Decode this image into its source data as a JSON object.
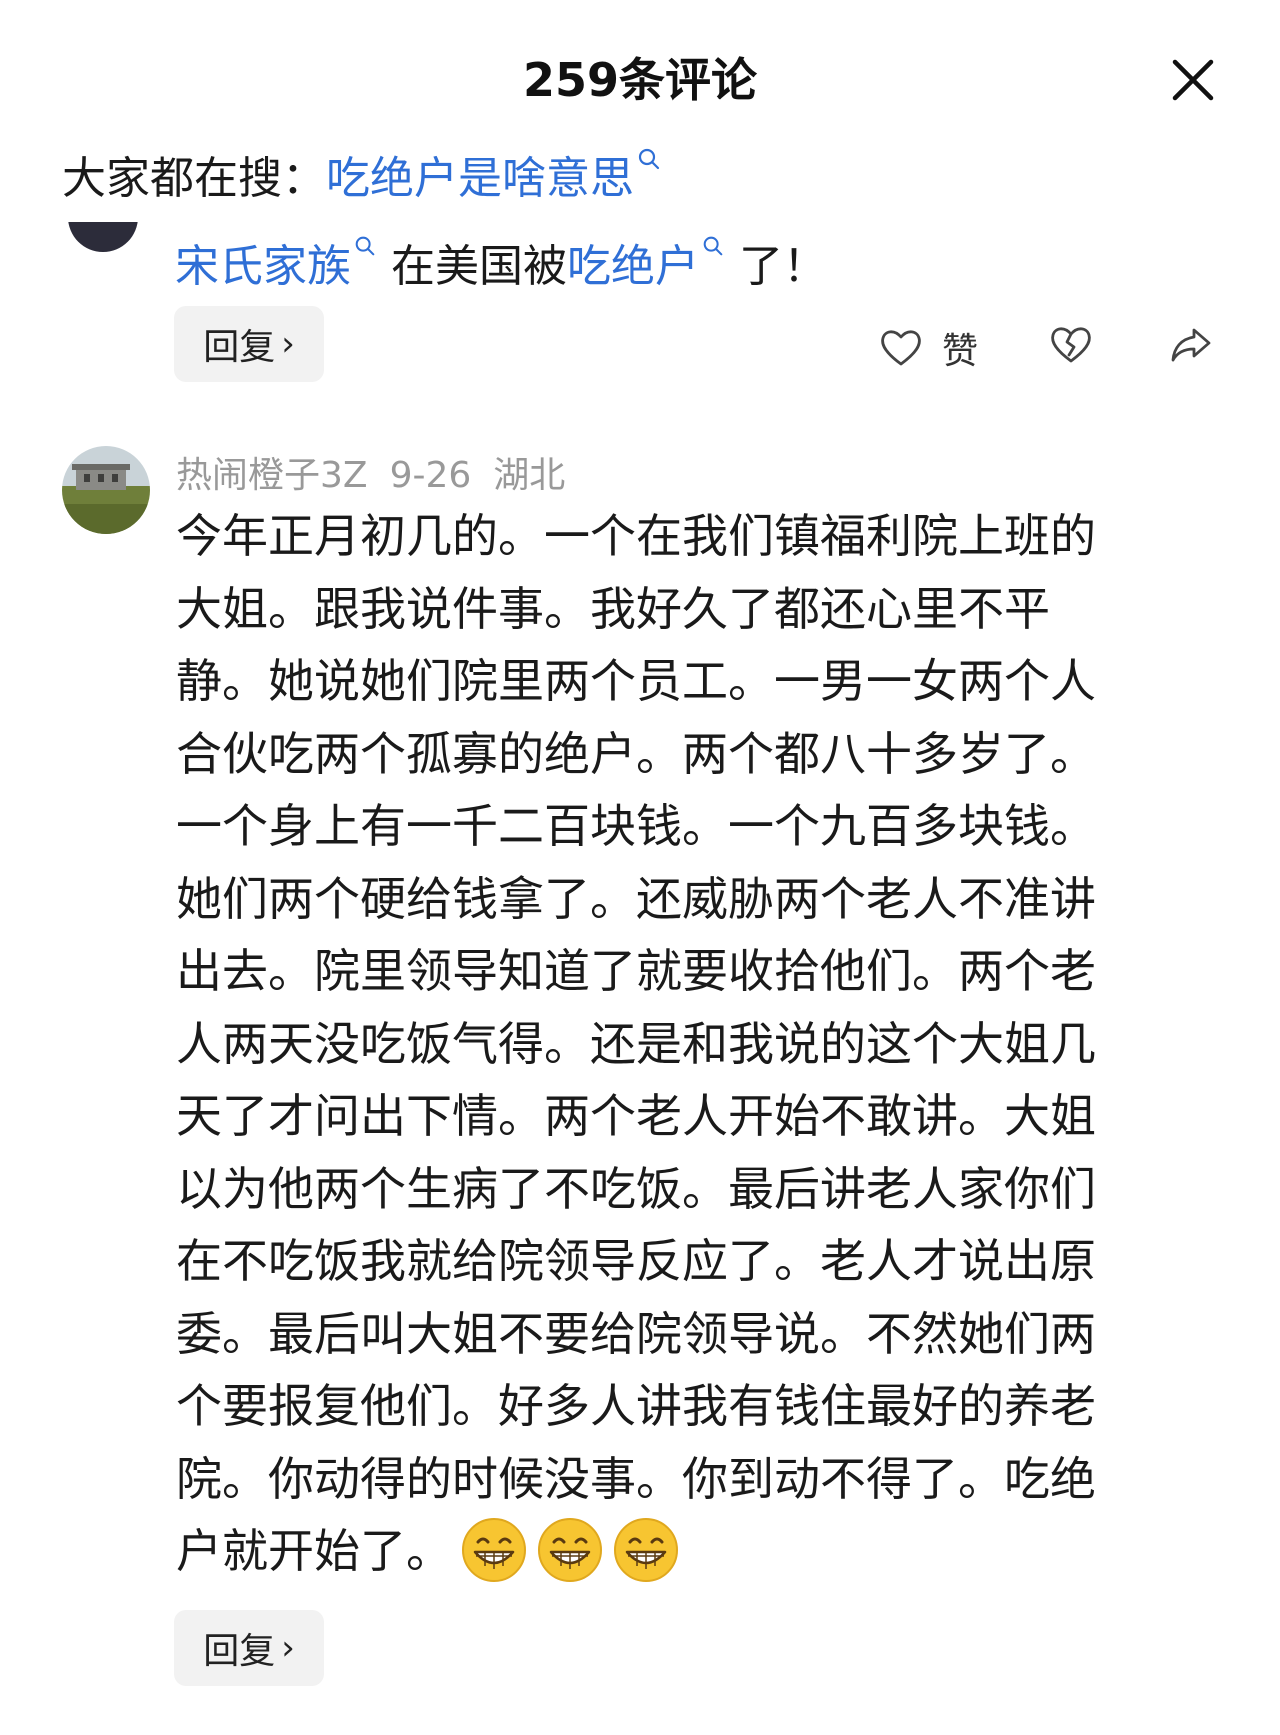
{
  "header": {
    "title": "259条评论"
  },
  "search": {
    "prefix": "大家都在搜：",
    "query": "吃绝户是啥意思"
  },
  "previous_comment": {
    "text_segments": [
      {
        "text": "宋氏家族",
        "link": true
      },
      {
        "text": " 在美国被",
        "link": false
      },
      {
        "text": "吃绝户",
        "link": true
      },
      {
        "text": " 了！",
        "link": false
      }
    ],
    "reply_label": "回复",
    "like_label": "赞"
  },
  "comment": {
    "author": "热闹橙子3Z",
    "date": "9-26",
    "location": "湖北",
    "lines": [
      "今年正月初几的。一个在我们镇福利院上班的",
      "大姐。跟我说件事。我好久了都还心里不平",
      "静。她说她们院里两个员工。一男一女两个人",
      "合伙吃两个孤寡的绝户。两个都八十多岁了。",
      "一个身上有一千二百块钱。一个九百多块钱。",
      "她们两个硬给钱拿了。还威胁两个老人不准讲",
      "出去。院里领导知道了就要收拾他们。两个老",
      "人两天没吃饭气得。还是和我说的这个大姐几",
      "天了才问出下情。两个老人开始不敢讲。大姐",
      "以为他两个生病了不吃饭。最后讲老人家你们",
      "在不吃饭我就给院领导反应了。老人才说出原",
      "委。最后叫大姐不要给院领导说。不然她们两",
      "个要报复他们。好多人讲我有钱住最好的养老",
      "院。你动得的时候没事。你到动不得了。吃绝"
    ],
    "last_line": "户就开始了。",
    "emojis": [
      "grin-emoji",
      "grin-emoji",
      "grin-emoji"
    ],
    "reply_label": "回复"
  },
  "colors": {
    "link": "#2f6fd6",
    "meta": "#999999",
    "reply_bg": "#f2f2f2"
  }
}
